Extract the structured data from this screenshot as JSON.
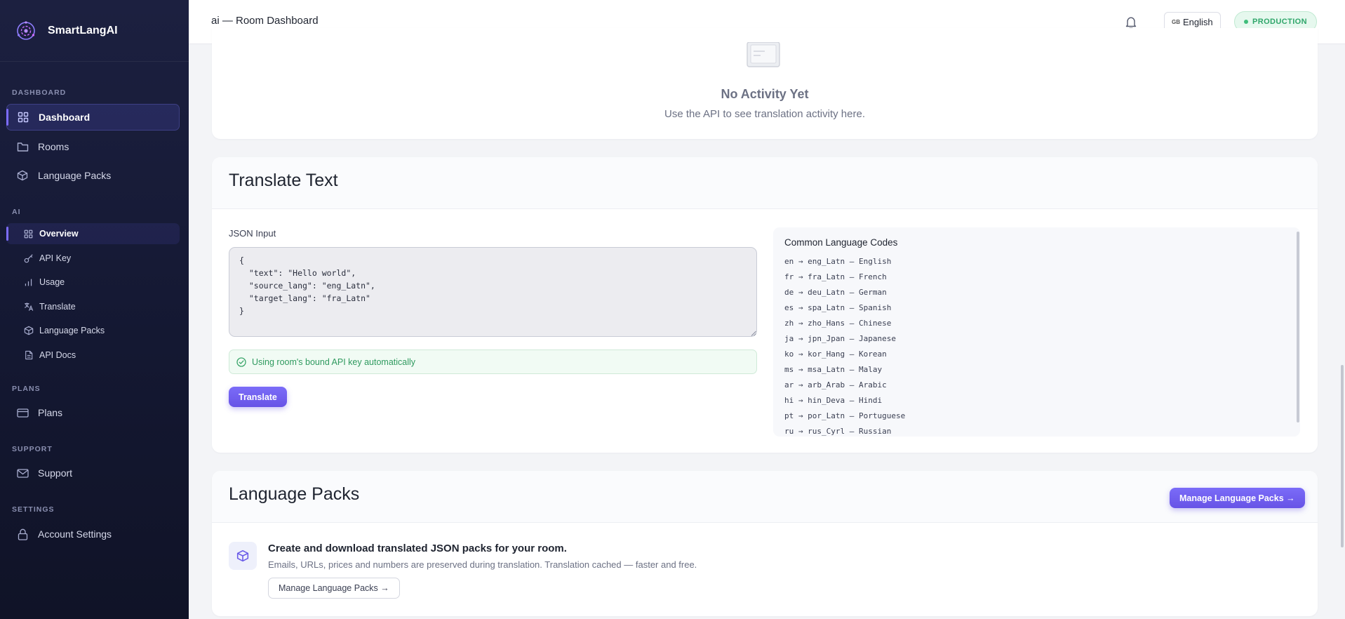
{
  "brand": {
    "name": "SmartLangAI"
  },
  "sidebar": {
    "sections": {
      "dashboard": "DASHBOARD",
      "ai": "AI",
      "plans": "PLANS",
      "support": "SUPPORT",
      "settings": "SETTINGS"
    },
    "items": {
      "dashboard": "Dashboard",
      "rooms": "Rooms",
      "language_packs": "Language Packs",
      "overview": "Overview",
      "api_key": "API Key",
      "usage": "Usage",
      "translate": "Translate",
      "ai_language_packs": "Language Packs",
      "api_docs": "API Docs",
      "plans": "Plans",
      "support": "Support",
      "account_settings": "Account Settings"
    }
  },
  "header": {
    "title": "ai — Room Dashboard",
    "language_flag": "GB",
    "language": "English",
    "environment": "PRODUCTION"
  },
  "activity": {
    "empty_title": "No Activity Yet",
    "empty_subtitle": "Use the API to see translation activity here."
  },
  "translate": {
    "heading": "Translate Text",
    "input_label": "JSON Input",
    "input_value": "{\n  \"text\": \"Hello world\",\n  \"source_lang\": \"eng_Latn\",\n  \"target_lang\": \"fra_Latn\"\n}",
    "notice": "Using room's bound API key automatically",
    "button": "Translate",
    "codes_title": "Common Language Codes",
    "codes": [
      "en → eng_Latn — English",
      "fr → fra_Latn — French",
      "de → deu_Latn — German",
      "es → spa_Latn — Spanish",
      "zh → zho_Hans — Chinese",
      "ja → jpn_Jpan — Japanese",
      "ko → kor_Hang — Korean",
      "ms → msa_Latn — Malay",
      "ar → arb_Arab — Arabic",
      "hi → hin_Deva — Hindi",
      "pt → por_Latn — Portuguese",
      "ru → rus_Cyrl — Russian"
    ]
  },
  "language_packs": {
    "heading": "Language Packs",
    "manage_button": "Manage Language Packs →",
    "title": "Create and download translated JSON packs for your room.",
    "subtitle": "Emails, URLs, prices and numbers are preserved during translation. Translation cached — faster and free.",
    "manage_link": "Manage Language Packs →"
  },
  "colors": {
    "sidebar_bg": "#141832",
    "accent": "#6753e6",
    "success": "#2f9a5f"
  }
}
